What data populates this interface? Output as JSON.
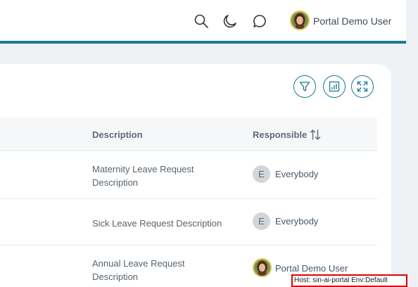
{
  "header": {
    "icons": [
      "search-icon",
      "moon-icon",
      "chat-icon"
    ],
    "user_name": "Portal Demo User"
  },
  "toolbar": {
    "buttons": [
      "filter-icon",
      "chart-icon",
      "expand-icon"
    ]
  },
  "table": {
    "columns": [
      "Description",
      "Responsible"
    ],
    "rows": [
      {
        "description": "Maternity Leave Request Description",
        "responsible_initial": "E",
        "responsible": "Everybody"
      },
      {
        "description": "Sick Leave Request Description",
        "responsible_initial": "E",
        "responsible": "Everybody"
      },
      {
        "description": "Annual Leave Request Description",
        "responsible_initial": "",
        "responsible": "Portal Demo User"
      }
    ]
  },
  "footer": {
    "host_info": "Host: sin-ai-portal Env:Default"
  },
  "colors": {
    "accent": "#1d7795",
    "host_border": "#e00000"
  }
}
